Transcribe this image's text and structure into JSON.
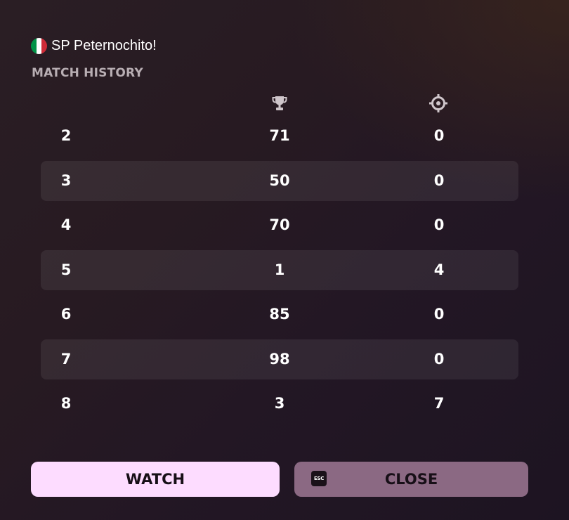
{
  "player": {
    "flag_icon": "italy-flag-icon",
    "flag_colors": [
      "#009246",
      "#ffffff",
      "#ce2b37"
    ],
    "name": "SP Peternochito!"
  },
  "history": {
    "title": "MATCH HISTORY",
    "score_icon": "trophy-icon",
    "kills_icon": "crosshair-icon",
    "rows": [
      {
        "index": "2",
        "score": "71",
        "kills": "0"
      },
      {
        "index": "3",
        "score": "50",
        "kills": "0"
      },
      {
        "index": "4",
        "score": "70",
        "kills": "0"
      },
      {
        "index": "5",
        "score": "1",
        "kills": "4"
      },
      {
        "index": "6",
        "score": "85",
        "kills": "0"
      },
      {
        "index": "7",
        "score": "98",
        "kills": "0"
      },
      {
        "index": "8",
        "score": "3",
        "kills": "7"
      }
    ]
  },
  "buttons": {
    "watch_label": "WATCH",
    "close_label": "CLOSE",
    "close_key_label": "ESC",
    "watch_color": "#fddcff",
    "close_color": "#8b6983"
  }
}
